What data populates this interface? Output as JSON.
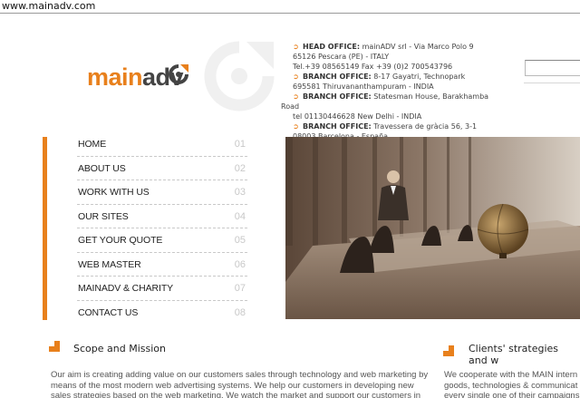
{
  "browser": {
    "url": "www.mainadv.com"
  },
  "logo": {
    "part1": "main",
    "part2": "adv"
  },
  "offices": [
    {
      "line1_label": "HEAD OFFICE:",
      "line1_text": " mainADV srl - Via Marco Polo 9",
      "lines": [
        "65126 Pescara (PE) - ITALY",
        "Tel.+39 08565149 Fax +39 (0)2 700543796"
      ]
    },
    {
      "line1_label": "BRANCH OFFICE:",
      "line1_text": " 8-17 Gayatri, Technopark",
      "lines": [
        "695581 Thiruvananthampuram - INDIA"
      ]
    },
    {
      "line1_label": "BRANCH OFFICE:",
      "line1_text": " Statesman House, Barakhamba",
      "lines": [
        "Road",
        "tel 01130446628 New Delhi - INDIA"
      ]
    },
    {
      "line1_label": "BRANCH OFFICE:",
      "line1_text": " Travessera de gràcia 56, 3-1",
      "lines": [
        "08003 Barcelona - España"
      ]
    }
  ],
  "search": {
    "value": ""
  },
  "menu": [
    {
      "label": "HOME",
      "num": "01"
    },
    {
      "label": "ABOUT US",
      "num": "02"
    },
    {
      "label": "WORK WITH US",
      "num": "03"
    },
    {
      "label": "OUR SITES",
      "num": "04"
    },
    {
      "label": "GET YOUR QUOTE",
      "num": "05"
    },
    {
      "label": "WEB MASTER",
      "num": "06"
    },
    {
      "label": "MAINADV & CHARITY",
      "num": "07"
    },
    {
      "label": "CONTACT US",
      "num": "08"
    }
  ],
  "scope": {
    "title": "Scope and Mission",
    "lines": [
      "Our aim is creating adding value on our customers sales through technology and web marketing by",
      "means of the most modern web advertising systems. We help our customers in developing new",
      "sales strategies based on the web marketing. We watch the market and support our customers in"
    ]
  },
  "clients": {
    "title": "Clients' strategies and w",
    "lines": [
      "We cooperate with the MAIN intern",
      "goods, technologies & communicat",
      "every single one of their campaigns"
    ]
  },
  "colors": {
    "accent": "#e8801c",
    "text": "#333333"
  }
}
